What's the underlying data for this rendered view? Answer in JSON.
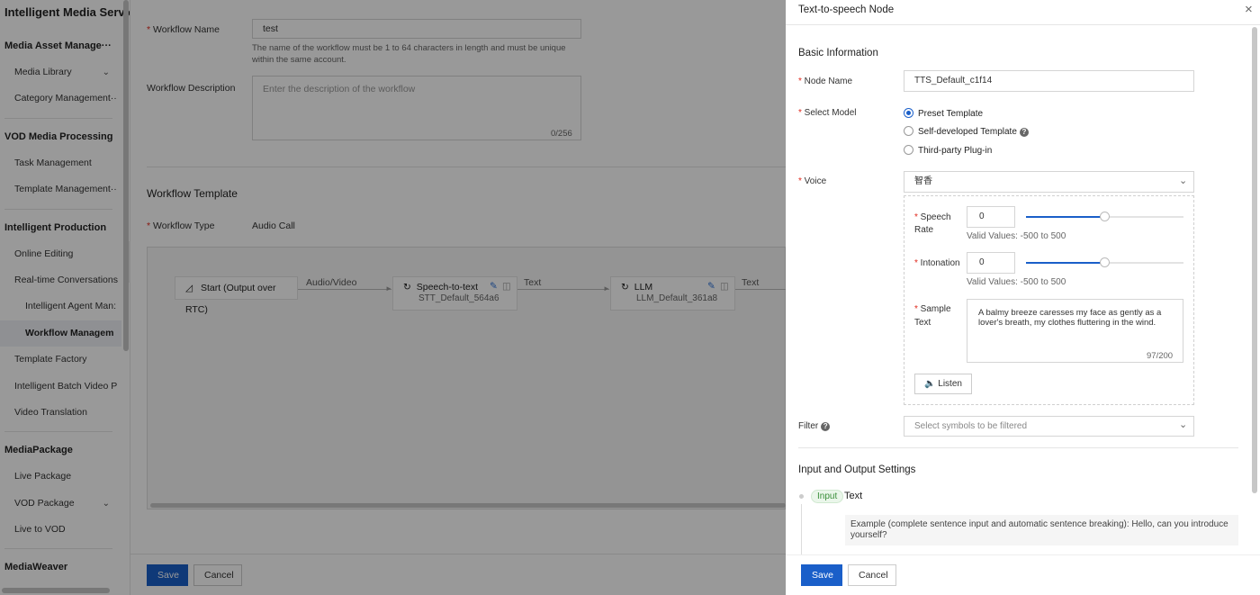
{
  "sidebar": {
    "title": "Intelligent Media Servic",
    "groups": [
      {
        "label": "Media Asset Manage···",
        "items": [
          {
            "label": "Media Library",
            "chevron": true
          },
          {
            "label": "Category Management··"
          }
        ]
      },
      {
        "label": "VOD Media Processing",
        "items": [
          {
            "label": "Task Management"
          },
          {
            "label": "Template Management··"
          }
        ]
      },
      {
        "label": "Intelligent Production",
        "items": [
          {
            "label": "Online Editing"
          },
          {
            "label": "Real-time Conversations"
          },
          {
            "label": "Intelligent Agent Man:",
            "sub": true
          },
          {
            "label": "Workflow Managem",
            "sub": true,
            "active": true
          },
          {
            "label": "Template Factory"
          },
          {
            "label": "Intelligent Batch Video P"
          },
          {
            "label": "Video Translation"
          }
        ]
      },
      {
        "label": "MediaPackage",
        "items": [
          {
            "label": "Live Package"
          },
          {
            "label": "VOD Package",
            "chevron": true
          },
          {
            "label": "Live to VOD"
          }
        ]
      },
      {
        "label": "MediaWeaver",
        "items": []
      }
    ]
  },
  "main": {
    "workflow_name_label": "Workflow Name",
    "workflow_name_value": "test",
    "workflow_name_help": "The name of the workflow must be 1 to 64 characters in length and must be unique within the same account.",
    "workflow_desc_label": "Workflow Description",
    "workflow_desc_placeholder": "Enter the description of the workflow",
    "workflow_desc_count": "0/256",
    "template_section_title": "Workflow Template",
    "workflow_type_label": "Workflow Type",
    "workflow_type_value": "Audio Call",
    "nodes": {
      "start": {
        "label": "Start (Output over RTC)"
      },
      "stt": {
        "label": "Speech-to-text",
        "id": "STT_Default_564a6"
      },
      "llm": {
        "label": "LLM",
        "id": "LLM_Default_361a8"
      }
    },
    "edges": {
      "e1": "Audio/Video",
      "e2": "Text",
      "e3": "Text"
    },
    "save_label": "Save",
    "cancel_label": "Cancel"
  },
  "drawer": {
    "title": "Text-to-speech Node",
    "close_symbol": "×",
    "basic_info_title": "Basic Information",
    "node_name_label": "Node Name",
    "node_name_value": "TTS_Default_c1f14",
    "select_model_label": "Select Model",
    "model_options": [
      "Preset Template",
      "Self-developed Template",
      "Third-party Plug-in"
    ],
    "model_selected_index": 0,
    "voice_label": "Voice",
    "voice_value": "智香",
    "speech_rate_label_1": "Speech",
    "speech_rate_label_2": "Rate",
    "speech_rate_value": "0",
    "speech_rate_help": "Valid Values: -500 to 500",
    "speech_rate_range": [
      -500,
      500
    ],
    "intonation_label": "Intonation",
    "intonation_value": "0",
    "intonation_help": "Valid Values: -500 to 500",
    "intonation_range": [
      -500,
      500
    ],
    "sample_text_label_1": "Sample",
    "sample_text_label_2": "Text",
    "sample_text_value": "A balmy breeze caresses my face as gently as a lover's breath, my clothes fluttering in the wind.",
    "sample_text_count": "97/200",
    "listen_label": "Listen",
    "filter_label": "Filter",
    "filter_placeholder": "Select symbols to be filtered",
    "io_title": "Input and Output Settings",
    "input_badge": "Input",
    "input_type": "Text",
    "input_example": "Example (complete sentence input and automatic sentence breaking): Hello, can you introduce yourself?",
    "save_label": "Save",
    "cancel_label": "Cancel",
    "accent_color": "#1a5fc9"
  }
}
